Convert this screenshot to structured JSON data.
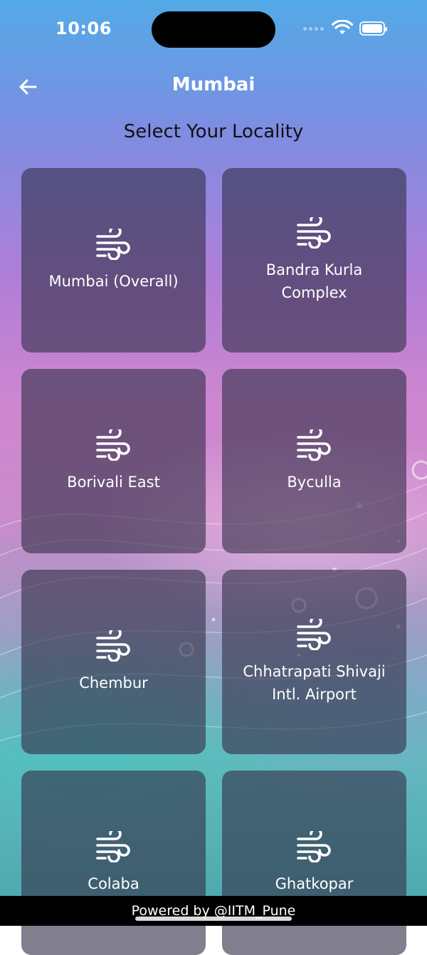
{
  "status_bar": {
    "time": "10:06",
    "wifi_icon": "wifi-icon",
    "battery_icon": "battery-icon"
  },
  "header": {
    "title": "Mumbai",
    "back_icon": "arrow-left-icon"
  },
  "subtitle": "Select Your Locality",
  "localities": [
    {
      "label": "Mumbai (Overall)",
      "icon": "wind-icon"
    },
    {
      "label": "Bandra Kurla Complex",
      "icon": "wind-icon"
    },
    {
      "label": "Borivali East",
      "icon": "wind-icon"
    },
    {
      "label": "Byculla",
      "icon": "wind-icon"
    },
    {
      "label": "Chembur",
      "icon": "wind-icon"
    },
    {
      "label": "Chhatrapati Shivaji Intl. Airport",
      "icon": "wind-icon"
    },
    {
      "label": "Colaba",
      "icon": "wind-icon"
    },
    {
      "label": "Ghatkopar",
      "icon": "wind-icon"
    }
  ],
  "footer": {
    "text": "Powered by @IITM_Pune"
  },
  "colors": {
    "card_bg": "#34304a",
    "text": "#ffffff",
    "subtitle": "#111111"
  }
}
